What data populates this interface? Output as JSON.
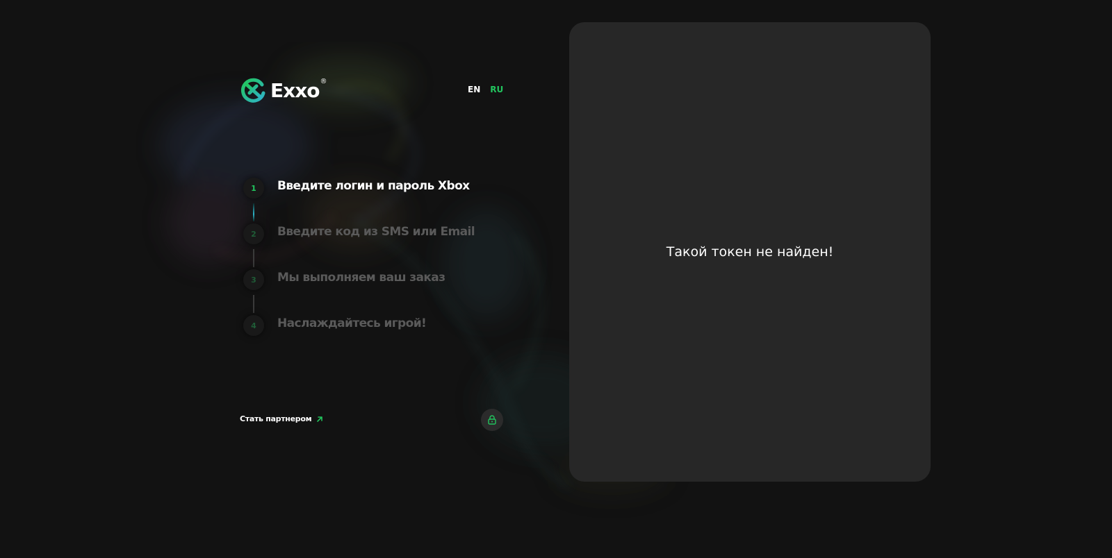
{
  "brand": {
    "name": "Exxo",
    "registered_mark": "®",
    "accent_color": "#22c55e",
    "secondary_color": "#2fb4c7"
  },
  "language_switch": {
    "options": [
      {
        "label": "EN",
        "active": false
      },
      {
        "label": "RU",
        "active": true
      }
    ]
  },
  "steps": [
    {
      "number": "1",
      "label": "Введите логин и пароль Xbox",
      "active": true
    },
    {
      "number": "2",
      "label": "Введите код из SMS или Email",
      "active": false
    },
    {
      "number": "3",
      "label": "Мы выполняем ваш заказ",
      "active": false
    },
    {
      "number": "4",
      "label": "Наслаждайтесь игрой!",
      "active": false
    }
  ],
  "footer": {
    "partner_label": "Стать партнером",
    "partner_icon": "arrow-up-right-icon",
    "lock_icon": "lock-icon"
  },
  "panel": {
    "message": "Такой токен не найден!"
  }
}
